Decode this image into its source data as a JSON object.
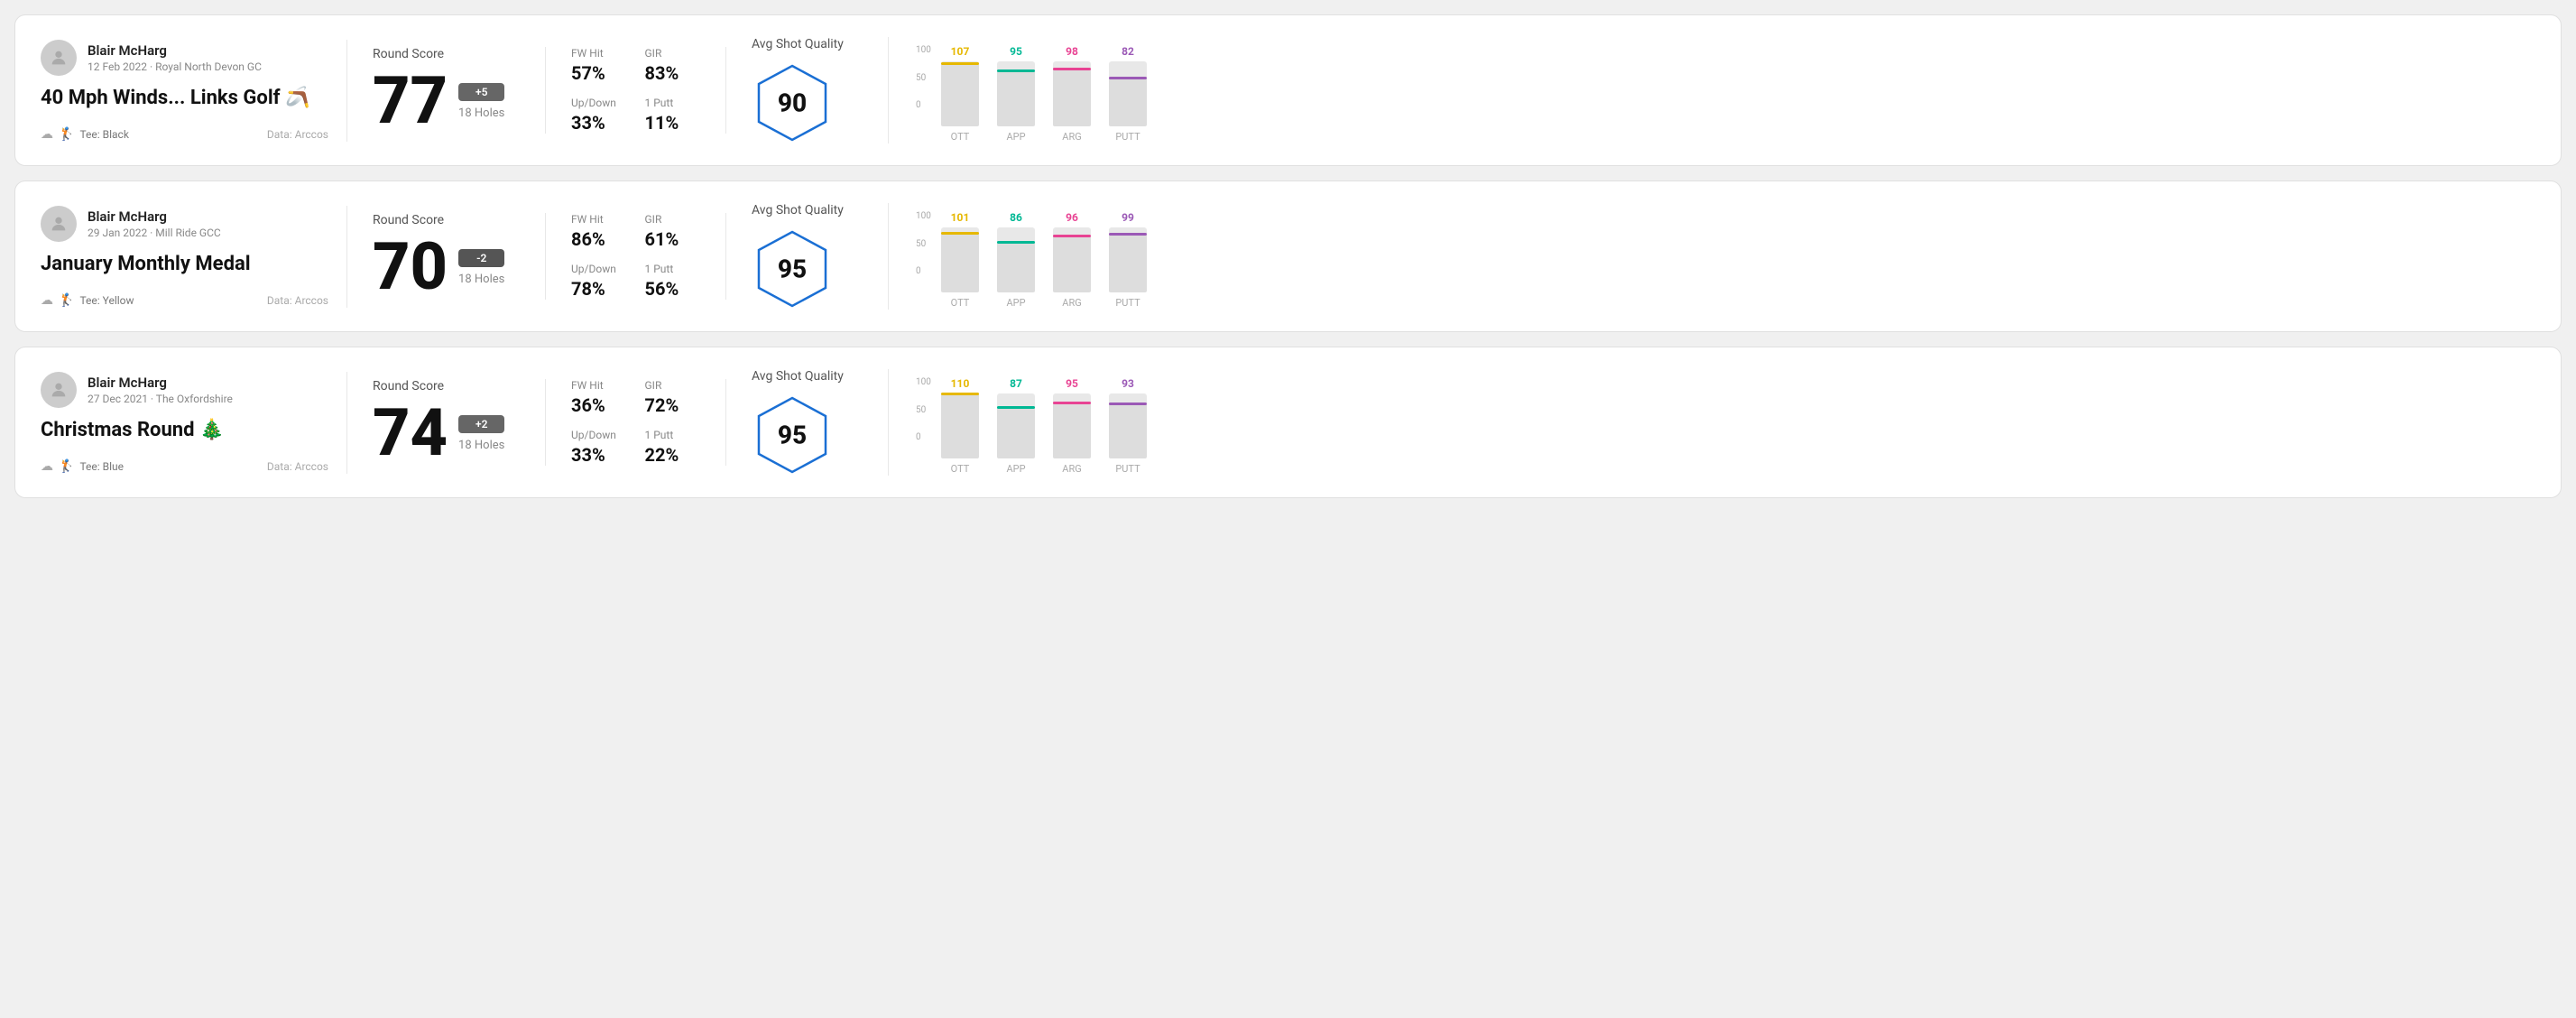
{
  "rounds": [
    {
      "id": "round1",
      "user_name": "Blair McHarg",
      "user_date": "12 Feb 2022 · Royal North Devon GC",
      "title": "40 Mph Winds... Links Golf 🪃",
      "tee": "Tee: Black",
      "data_source": "Data: Arccos",
      "score": "77",
      "score_diff": "+5",
      "holes": "18 Holes",
      "fw_hit": "57%",
      "gir": "83%",
      "up_down": "33%",
      "one_putt": "11%",
      "avg_quality": "90",
      "bars": [
        {
          "label": "OTT",
          "value": 107,
          "color": "#e6b800",
          "max": 107
        },
        {
          "label": "APP",
          "value": 95,
          "color": "#00b894",
          "max": 107
        },
        {
          "label": "ARG",
          "value": 98,
          "color": "#e84393",
          "max": 107
        },
        {
          "label": "PUTT",
          "value": 82,
          "color": "#e84393",
          "max": 107
        }
      ]
    },
    {
      "id": "round2",
      "user_name": "Blair McHarg",
      "user_date": "29 Jan 2022 · Mill Ride GCC",
      "title": "January Monthly Medal",
      "tee": "Tee: Yellow",
      "data_source": "Data: Arccos",
      "score": "70",
      "score_diff": "-2",
      "holes": "18 Holes",
      "fw_hit": "86%",
      "gir": "61%",
      "up_down": "78%",
      "one_putt": "56%",
      "avg_quality": "95",
      "bars": [
        {
          "label": "OTT",
          "value": 101,
          "color": "#e6b800",
          "max": 101
        },
        {
          "label": "APP",
          "value": 86,
          "color": "#00b894",
          "max": 101
        },
        {
          "label": "ARG",
          "value": 96,
          "color": "#e84393",
          "max": 101
        },
        {
          "label": "PUTT",
          "value": 99,
          "color": "#e84393",
          "max": 101
        }
      ]
    },
    {
      "id": "round3",
      "user_name": "Blair McHarg",
      "user_date": "27 Dec 2021 · The Oxfordshire",
      "title": "Christmas Round 🎄",
      "tee": "Tee: Blue",
      "data_source": "Data: Arccos",
      "score": "74",
      "score_diff": "+2",
      "holes": "18 Holes",
      "fw_hit": "36%",
      "gir": "72%",
      "up_down": "33%",
      "one_putt": "22%",
      "avg_quality": "95",
      "bars": [
        {
          "label": "OTT",
          "value": 110,
          "color": "#e6b800",
          "max": 110
        },
        {
          "label": "APP",
          "value": 87,
          "color": "#00b894",
          "max": 110
        },
        {
          "label": "ARG",
          "value": 95,
          "color": "#e84393",
          "max": 110
        },
        {
          "label": "PUTT",
          "value": 93,
          "color": "#e84393",
          "max": 110
        }
      ]
    }
  ],
  "labels": {
    "round_score": "Round Score",
    "fw_hit": "FW Hit",
    "gir": "GIR",
    "up_down": "Up/Down",
    "one_putt": "1 Putt",
    "avg_quality": "Avg Shot Quality",
    "y_100": "100",
    "y_50": "50",
    "y_0": "0"
  }
}
